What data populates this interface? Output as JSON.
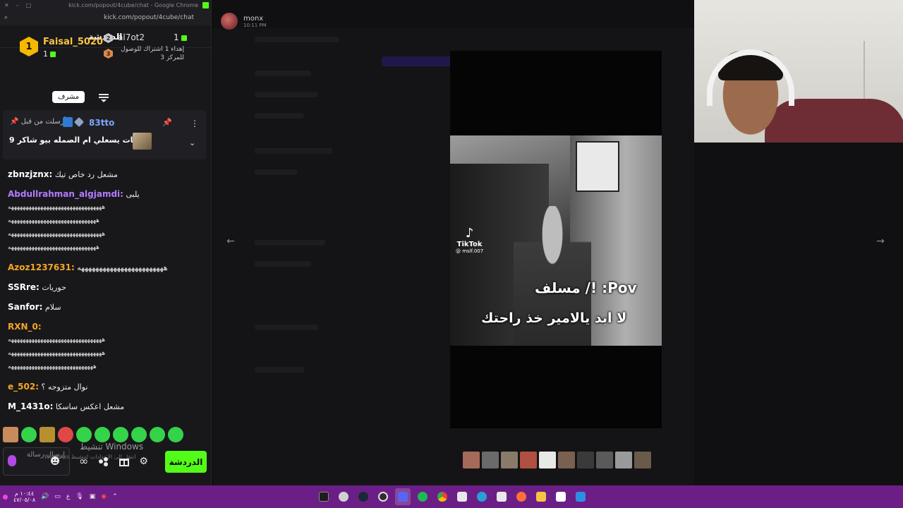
{
  "browser": {
    "window_title": "kick.com/popout/4cube/chat - Google Chrome",
    "url": "kick.com/popout/4cube/chat"
  },
  "chat": {
    "header_title": "الدردشة",
    "leaderboard": {
      "first": {
        "rank": "1",
        "name": "Faisal_5020",
        "count": "1"
      },
      "second": {
        "name": "al7ot2",
        "count": "1"
      },
      "gift_text": "إهداء 1 اشتراك للوصول للمركز 3"
    },
    "mod_tooltip": "مشرف",
    "pinned": {
      "sent_by_label": "أرسلت من قبل",
      "user": "83tto",
      "message": "ساعات يسعلي ام الصمله بيو شاكر 9"
    },
    "messages": [
      {
        "user": "zbnzjznx:",
        "text": "مشعل رد خاص تيك",
        "color": "#ffffff"
      },
      {
        "user": "Abdullrahman_algjamdi:",
        "text": "يلبى",
        "color": "#b57bff",
        "long": [
          "ههههههههههههههههههههههههههههههههه",
          "ههههههههههههههههههههههههههههههه",
          "ههههههههههههههههههههههههههههههههه",
          "ههههههههههههههههههههههههههههههه"
        ]
      },
      {
        "user": "Azoz1237631:",
        "text": "ههههههههههههههههههههههههه",
        "color": "#f5a623"
      },
      {
        "user": "SSRre:",
        "text": "حوريات",
        "color": "#ffffff"
      },
      {
        "user": "Sanfor:",
        "text": "سلام",
        "color": "#ffffff"
      },
      {
        "user": "RXN_0:",
        "text": "",
        "color": "#f5a623",
        "long": [
          "ههههههههههههههههههههههههههههههههه",
          "ههههههههههههههههههههههههههههههههه",
          "هههههههههههههههههههههههههههههه"
        ]
      },
      {
        "user": "e_502:",
        "text": "نوال متزوجه ؟",
        "color": "#f5a623"
      },
      {
        "user": "M_1431o:",
        "text": "مشعل اعكس ساسكا",
        "color": "#ffffff"
      }
    ],
    "windows_activation": "تنشيط Windows",
    "windows_activation_sub": "انتقل إلى الإعدادات لتنشيط Windows.",
    "input_placeholder": "إرسال رسالة",
    "send_label": "الدردشة"
  },
  "post": {
    "user": "monx",
    "time": "10:11 PM"
  },
  "video": {
    "tiktok_word": "TikTok",
    "tiktok_handle": "@ mslf.007",
    "caption_top": "Pov: !/ مسلف",
    "caption_bottom": "لا ابد يالامير خذ راحتك"
  },
  "taskbar": {
    "lang": "ع",
    "clock_time": "١٠:٤٤ م",
    "clock_date": "٤٧/٠٥/٠٨"
  },
  "colors": {
    "kick_green": "#53fc18",
    "taskbar": "#6b1f86",
    "chat_bg": "#18181b"
  }
}
